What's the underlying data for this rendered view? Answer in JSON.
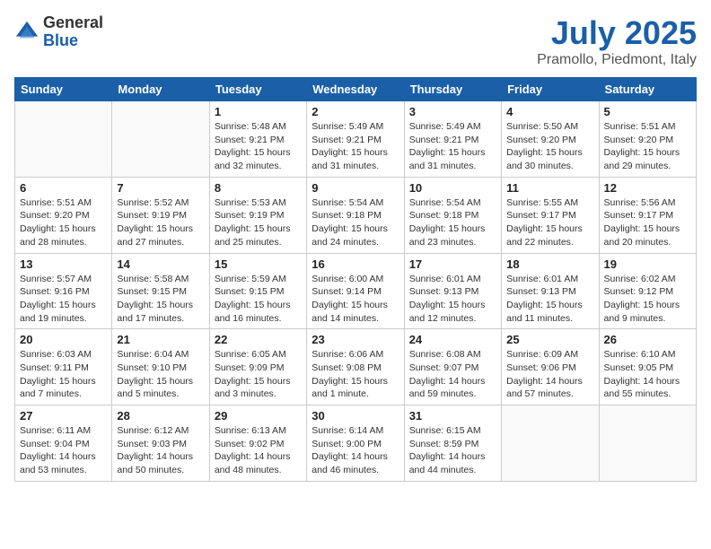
{
  "logo": {
    "general": "General",
    "blue": "Blue"
  },
  "title": "July 2025",
  "location": "Pramollo, Piedmont, Italy",
  "days_of_week": [
    "Sunday",
    "Monday",
    "Tuesday",
    "Wednesday",
    "Thursday",
    "Friday",
    "Saturday"
  ],
  "weeks": [
    [
      {
        "day": "",
        "info": ""
      },
      {
        "day": "",
        "info": ""
      },
      {
        "day": "1",
        "info": "Sunrise: 5:48 AM\nSunset: 9:21 PM\nDaylight: 15 hours and 32 minutes."
      },
      {
        "day": "2",
        "info": "Sunrise: 5:49 AM\nSunset: 9:21 PM\nDaylight: 15 hours and 31 minutes."
      },
      {
        "day": "3",
        "info": "Sunrise: 5:49 AM\nSunset: 9:21 PM\nDaylight: 15 hours and 31 minutes."
      },
      {
        "day": "4",
        "info": "Sunrise: 5:50 AM\nSunset: 9:20 PM\nDaylight: 15 hours and 30 minutes."
      },
      {
        "day": "5",
        "info": "Sunrise: 5:51 AM\nSunset: 9:20 PM\nDaylight: 15 hours and 29 minutes."
      }
    ],
    [
      {
        "day": "6",
        "info": "Sunrise: 5:51 AM\nSunset: 9:20 PM\nDaylight: 15 hours and 28 minutes."
      },
      {
        "day": "7",
        "info": "Sunrise: 5:52 AM\nSunset: 9:19 PM\nDaylight: 15 hours and 27 minutes."
      },
      {
        "day": "8",
        "info": "Sunrise: 5:53 AM\nSunset: 9:19 PM\nDaylight: 15 hours and 25 minutes."
      },
      {
        "day": "9",
        "info": "Sunrise: 5:54 AM\nSunset: 9:18 PM\nDaylight: 15 hours and 24 minutes."
      },
      {
        "day": "10",
        "info": "Sunrise: 5:54 AM\nSunset: 9:18 PM\nDaylight: 15 hours and 23 minutes."
      },
      {
        "day": "11",
        "info": "Sunrise: 5:55 AM\nSunset: 9:17 PM\nDaylight: 15 hours and 22 minutes."
      },
      {
        "day": "12",
        "info": "Sunrise: 5:56 AM\nSunset: 9:17 PM\nDaylight: 15 hours and 20 minutes."
      }
    ],
    [
      {
        "day": "13",
        "info": "Sunrise: 5:57 AM\nSunset: 9:16 PM\nDaylight: 15 hours and 19 minutes."
      },
      {
        "day": "14",
        "info": "Sunrise: 5:58 AM\nSunset: 9:15 PM\nDaylight: 15 hours and 17 minutes."
      },
      {
        "day": "15",
        "info": "Sunrise: 5:59 AM\nSunset: 9:15 PM\nDaylight: 15 hours and 16 minutes."
      },
      {
        "day": "16",
        "info": "Sunrise: 6:00 AM\nSunset: 9:14 PM\nDaylight: 15 hours and 14 minutes."
      },
      {
        "day": "17",
        "info": "Sunrise: 6:01 AM\nSunset: 9:13 PM\nDaylight: 15 hours and 12 minutes."
      },
      {
        "day": "18",
        "info": "Sunrise: 6:01 AM\nSunset: 9:13 PM\nDaylight: 15 hours and 11 minutes."
      },
      {
        "day": "19",
        "info": "Sunrise: 6:02 AM\nSunset: 9:12 PM\nDaylight: 15 hours and 9 minutes."
      }
    ],
    [
      {
        "day": "20",
        "info": "Sunrise: 6:03 AM\nSunset: 9:11 PM\nDaylight: 15 hours and 7 minutes."
      },
      {
        "day": "21",
        "info": "Sunrise: 6:04 AM\nSunset: 9:10 PM\nDaylight: 15 hours and 5 minutes."
      },
      {
        "day": "22",
        "info": "Sunrise: 6:05 AM\nSunset: 9:09 PM\nDaylight: 15 hours and 3 minutes."
      },
      {
        "day": "23",
        "info": "Sunrise: 6:06 AM\nSunset: 9:08 PM\nDaylight: 15 hours and 1 minute."
      },
      {
        "day": "24",
        "info": "Sunrise: 6:08 AM\nSunset: 9:07 PM\nDaylight: 14 hours and 59 minutes."
      },
      {
        "day": "25",
        "info": "Sunrise: 6:09 AM\nSunset: 9:06 PM\nDaylight: 14 hours and 57 minutes."
      },
      {
        "day": "26",
        "info": "Sunrise: 6:10 AM\nSunset: 9:05 PM\nDaylight: 14 hours and 55 minutes."
      }
    ],
    [
      {
        "day": "27",
        "info": "Sunrise: 6:11 AM\nSunset: 9:04 PM\nDaylight: 14 hours and 53 minutes."
      },
      {
        "day": "28",
        "info": "Sunrise: 6:12 AM\nSunset: 9:03 PM\nDaylight: 14 hours and 50 minutes."
      },
      {
        "day": "29",
        "info": "Sunrise: 6:13 AM\nSunset: 9:02 PM\nDaylight: 14 hours and 48 minutes."
      },
      {
        "day": "30",
        "info": "Sunrise: 6:14 AM\nSunset: 9:00 PM\nDaylight: 14 hours and 46 minutes."
      },
      {
        "day": "31",
        "info": "Sunrise: 6:15 AM\nSunset: 8:59 PM\nDaylight: 14 hours and 44 minutes."
      },
      {
        "day": "",
        "info": ""
      },
      {
        "day": "",
        "info": ""
      }
    ]
  ]
}
